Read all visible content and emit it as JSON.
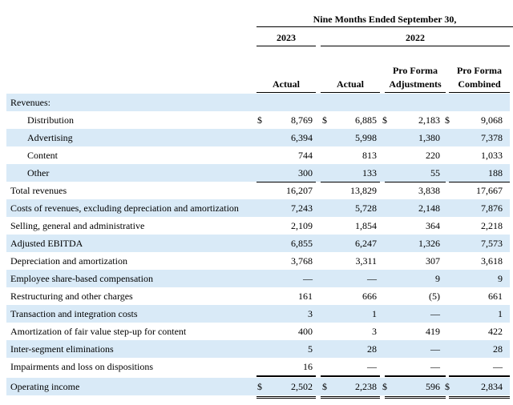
{
  "header": {
    "period": "Nine Months Ended September 30,",
    "year_2023": "2023",
    "year_2022": "2022",
    "cols": [
      {
        "line1": "",
        "line2": "Actual"
      },
      {
        "line1": "",
        "line2": "Actual"
      },
      {
        "line1": "Pro Forma",
        "line2": "Adjustments"
      },
      {
        "line1": "Pro Forma",
        "line2": "Combined"
      }
    ]
  },
  "currency_symbol": "$",
  "rows": [
    {
      "label": "Revenues:",
      "values": [
        "",
        "",
        "",
        ""
      ],
      "indent": false,
      "shaded": true,
      "dollar": false
    },
    {
      "label": "Distribution",
      "values": [
        "8,769",
        "6,885",
        "2,183",
        "9,068"
      ],
      "indent": true,
      "shaded": false,
      "dollar": true
    },
    {
      "label": "Advertising",
      "values": [
        "6,394",
        "5,998",
        "1,380",
        "7,378"
      ],
      "indent": true,
      "shaded": true,
      "dollar": false
    },
    {
      "label": "Content",
      "values": [
        "744",
        "813",
        "220",
        "1,033"
      ],
      "indent": true,
      "shaded": false,
      "dollar": false
    },
    {
      "label": "Other",
      "values": [
        "300",
        "133",
        "55",
        "188"
      ],
      "indent": true,
      "shaded": true,
      "dollar": false
    },
    {
      "label": "Total revenues",
      "values": [
        "16,207",
        "13,829",
        "3,838",
        "17,667"
      ],
      "indent": false,
      "shaded": false,
      "dollar": false
    },
    {
      "label": "Costs of revenues, excluding depreciation and amortization",
      "values": [
        "7,243",
        "5,728",
        "2,148",
        "7,876"
      ],
      "indent": false,
      "shaded": true,
      "dollar": false
    },
    {
      "label": "Selling, general and administrative",
      "values": [
        "2,109",
        "1,854",
        "364",
        "2,218"
      ],
      "indent": false,
      "shaded": false,
      "dollar": false
    },
    {
      "label": "Adjusted EBITDA",
      "values": [
        "6,855",
        "6,247",
        "1,326",
        "7,573"
      ],
      "indent": false,
      "shaded": true,
      "dollar": false
    },
    {
      "label": "Depreciation and amortization",
      "values": [
        "3,768",
        "3,311",
        "307",
        "3,618"
      ],
      "indent": false,
      "shaded": false,
      "dollar": false
    },
    {
      "label": "Employee share-based compensation",
      "values": [
        "—",
        "—",
        "9",
        "9"
      ],
      "indent": false,
      "shaded": true,
      "dollar": false
    },
    {
      "label": "Restructuring and other charges",
      "values": [
        "161",
        "666",
        "(5)",
        "661"
      ],
      "indent": false,
      "shaded": false,
      "dollar": false
    },
    {
      "label": "Transaction and integration costs",
      "values": [
        "3",
        "1",
        "—",
        "1"
      ],
      "indent": false,
      "shaded": true,
      "dollar": false
    },
    {
      "label": "Amortization of fair value step-up for content",
      "values": [
        "400",
        "3",
        "419",
        "422"
      ],
      "indent": false,
      "shaded": false,
      "dollar": false
    },
    {
      "label": "Inter-segment eliminations",
      "values": [
        "5",
        "28",
        "—",
        "28"
      ],
      "indent": false,
      "shaded": true,
      "dollar": false
    },
    {
      "label": "Impairments and loss on dispositions",
      "values": [
        "16",
        "—",
        "—",
        "—"
      ],
      "indent": false,
      "shaded": false,
      "dollar": false
    },
    {
      "label": "Operating income",
      "values": [
        "2,502",
        "2,238",
        "596",
        "2,834"
      ],
      "indent": false,
      "shaded": true,
      "dollar": true
    }
  ]
}
